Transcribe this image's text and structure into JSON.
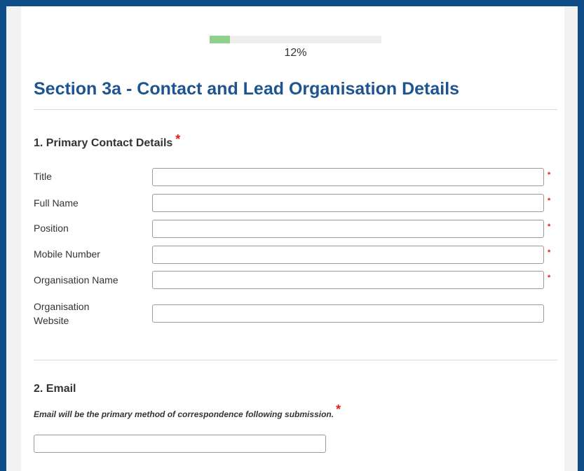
{
  "progress": {
    "percent": 12,
    "label": "12%",
    "fill_color": "#8fd18b"
  },
  "section": {
    "title": "Section 3a - Contact and Lead Organisation Details",
    "title_color": "#1e5591"
  },
  "q1": {
    "heading": "1. Primary Contact Details",
    "required_mark": "*",
    "fields": [
      {
        "label": "Title",
        "value": "",
        "required": true
      },
      {
        "label": "Full Name",
        "value": "",
        "required": true
      },
      {
        "label": "Position",
        "value": "",
        "required": true
      },
      {
        "label": "Mobile Number",
        "value": "",
        "required": true
      },
      {
        "label": "Organisation Name",
        "value": "",
        "required": true
      },
      {
        "label": "Organisation Website",
        "value": "",
        "required": false
      }
    ]
  },
  "q2": {
    "heading": "2. Email",
    "note": "Email will be the primary method of correspondence following submission.",
    "required_mark": "*",
    "value": ""
  },
  "colors": {
    "frame_border": "#0e4d87",
    "required": "#e02020"
  }
}
